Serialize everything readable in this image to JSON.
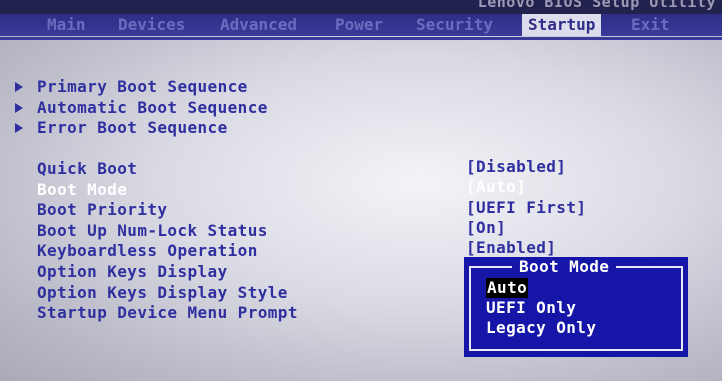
{
  "utility_title": "Lenovo BIOS Setup Utility",
  "menu": {
    "tabs": [
      {
        "label": "Main"
      },
      {
        "label": "Devices"
      },
      {
        "label": "Advanced"
      },
      {
        "label": "Power"
      },
      {
        "label": "Security"
      },
      {
        "label": "Startup",
        "active": true
      },
      {
        "label": "Exit"
      }
    ]
  },
  "submenus": [
    {
      "label": "Primary Boot Sequence"
    },
    {
      "label": "Automatic Boot Sequence"
    },
    {
      "label": "Error Boot Sequence"
    }
  ],
  "settings": [
    {
      "label": "Quick Boot",
      "value": "[Disabled]"
    },
    {
      "label": "Boot Mode",
      "value": "[Auto]",
      "selected": true
    },
    {
      "label": "Boot Priority",
      "value": "[UEFI First]"
    },
    {
      "label": "Boot Up Num-Lock Status",
      "value": "[On]"
    },
    {
      "label": "Keyboardless Operation",
      "value": "[Enabled]"
    },
    {
      "label": "Option Keys Display",
      "value": ""
    },
    {
      "label": "Option Keys Display Style",
      "value": ""
    },
    {
      "label": "Startup Device Menu Prompt",
      "value": ""
    }
  ],
  "popup": {
    "title": "Boot Mode",
    "options": [
      {
        "label": "Auto",
        "highlighted": true
      },
      {
        "label": "UEFI Only"
      },
      {
        "label": "Legacy Only"
      }
    ]
  },
  "colors": {
    "menubar": "#2e2e86",
    "item_text": "#2f2fa0",
    "selected_text": "#ffffff",
    "popup_bg": "#1515a8",
    "highlight_bg": "#000000"
  }
}
